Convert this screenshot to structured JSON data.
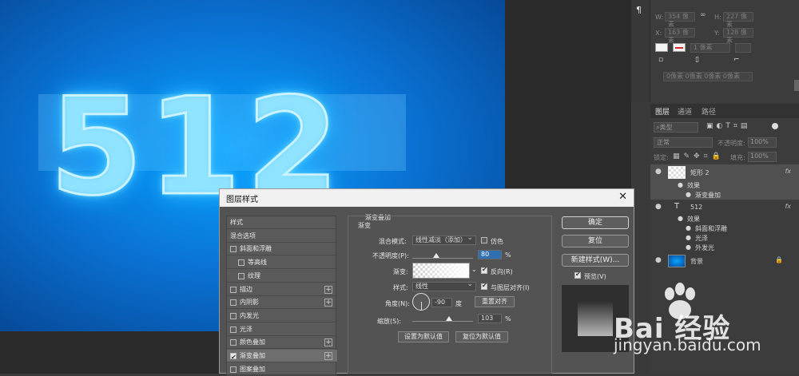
{
  "canvas": {
    "text": "512"
  },
  "properties": {
    "w_label": "W:",
    "w_value": "354 像素",
    "h_label": "H:",
    "h_value": "227 像素",
    "x_label": "X:",
    "x_value": "163 像素",
    "y_label": "Y:",
    "y_value": "128 像素",
    "stroke_width": "1 像素",
    "corner": "0像素 0像素 0像素 0像素"
  },
  "layers_panel": {
    "tabs": [
      "图层",
      "通道",
      "路径"
    ],
    "filter_kind": "类型",
    "blend_mode": "正常",
    "opacity_label": "不透明度:",
    "opacity_value": "100%",
    "lock_label": "锁定:",
    "fill_label": "填充:",
    "fill_value": "100%",
    "layers": [
      {
        "name": "矩形 2",
        "fx": "fx",
        "effects_label": "效果",
        "effects": [
          "渐变叠加"
        ]
      },
      {
        "name": "512",
        "fx": "fx",
        "effects_label": "效果",
        "effects": [
          "斜面和浮雕",
          "光泽",
          "外发光"
        ]
      },
      {
        "name": "背景"
      }
    ]
  },
  "dialog": {
    "title": "图层样式",
    "close": "✕",
    "style_list": [
      {
        "label": "样式",
        "checkbox": false,
        "plus": false
      },
      {
        "label": "混合选项",
        "checkbox": false,
        "plus": false
      },
      {
        "label": "斜面和浮雕",
        "checkbox": true,
        "checked": false,
        "plus": false
      },
      {
        "label": "等高线",
        "checkbox": true,
        "checked": false,
        "plus": false,
        "indent": true
      },
      {
        "label": "纹理",
        "checkbox": true,
        "checked": false,
        "plus": false,
        "indent": true
      },
      {
        "label": "描边",
        "checkbox": true,
        "checked": false,
        "plus": true
      },
      {
        "label": "内阴影",
        "checkbox": true,
        "checked": false,
        "plus": true
      },
      {
        "label": "内发光",
        "checkbox": true,
        "checked": false,
        "plus": false
      },
      {
        "label": "光泽",
        "checkbox": true,
        "checked": false,
        "plus": false
      },
      {
        "label": "颜色叠加",
        "checkbox": true,
        "checked": false,
        "plus": true
      },
      {
        "label": "渐变叠加",
        "checkbox": true,
        "checked": true,
        "plus": true,
        "active": true
      },
      {
        "label": "图案叠加",
        "checkbox": true,
        "checked": false,
        "plus": false
      }
    ],
    "section_title": "渐变叠加",
    "group_title": "渐变",
    "blend_mode_label": "混合模式:",
    "blend_mode_value": "线性减淡（添加）",
    "dither_label": "仿色",
    "opacity_label": "不透明度(P):",
    "opacity_value": "80",
    "opacity_unit": "%",
    "gradient_label": "渐变:",
    "reverse_label": "反向(R)",
    "style_label": "样式:",
    "style_value": "线性",
    "align_label": "与图层对齐(I)",
    "angle_label": "角度(N):",
    "angle_value": "-90",
    "angle_unit": "度",
    "reset_align": "重置对齐",
    "scale_label": "缩放(S):",
    "scale_value": "103",
    "scale_unit": "%",
    "make_default": "设置为默认值",
    "reset_default": "复位为默认值",
    "ok": "确定",
    "reset": "复位",
    "new_style": "新建样式(W)...",
    "preview_label": "预览(V)"
  },
  "watermark": {
    "logo": "Bai 经验",
    "url": "jingyan.baidu.com"
  },
  "colors": {
    "canvas_blue": "#0a74d6",
    "panel_bg": "#3c3c3c",
    "dialog_bg": "#535353"
  }
}
